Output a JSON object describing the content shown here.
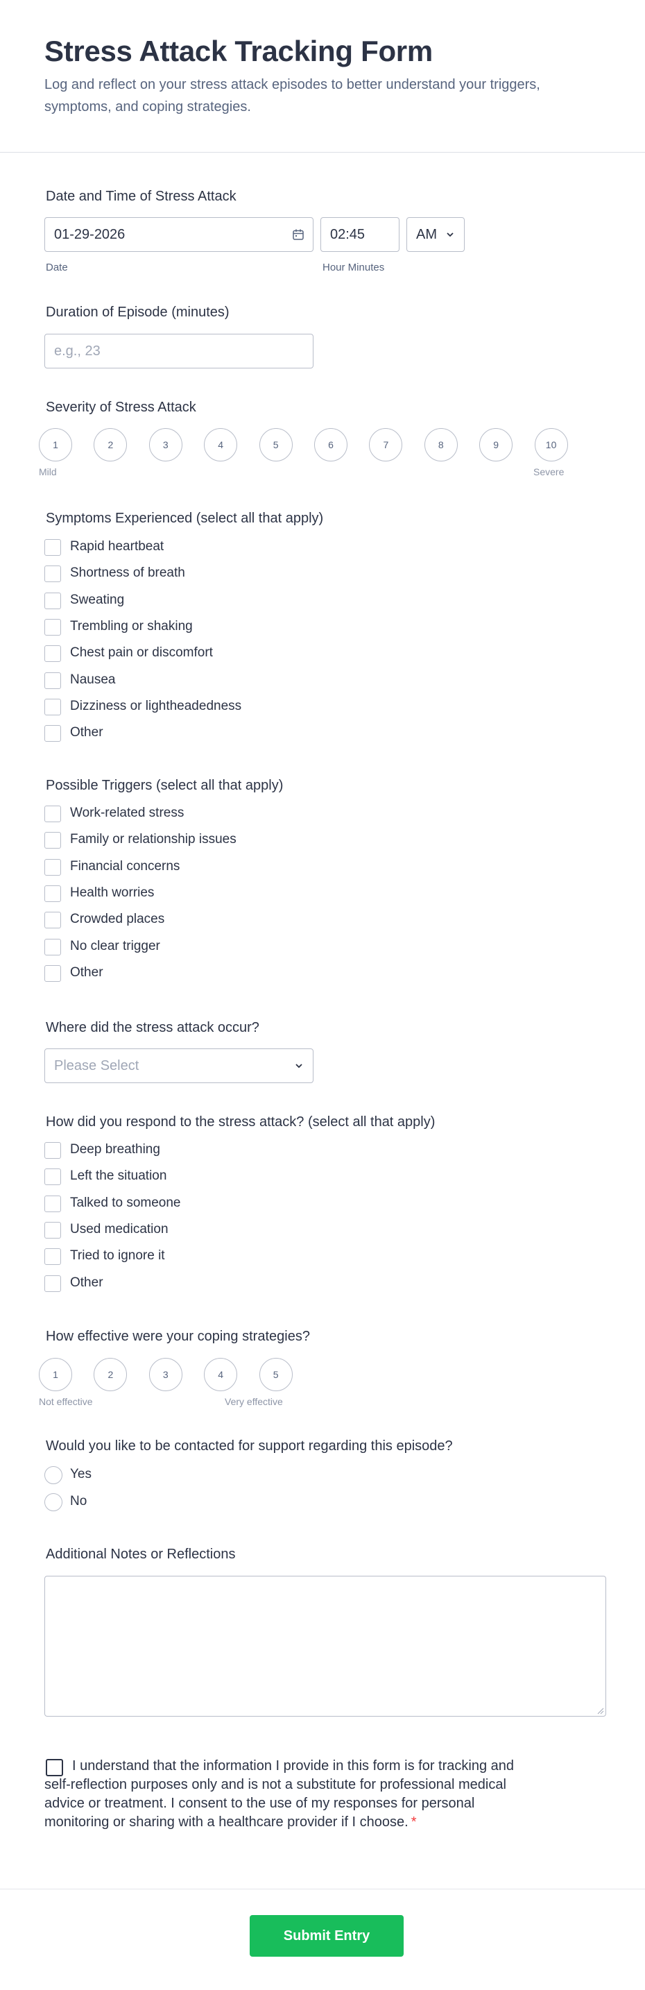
{
  "form": {
    "title": "Stress Attack Tracking Form",
    "subtitle": "Log and reflect on your stress attack episodes to better understand your triggers, symptoms, and coping strategies."
  },
  "datetime": {
    "label": "Date and Time of Stress Attack",
    "date_value": "01-29-2026",
    "date_sublabel": "Date",
    "time_value": "02:45",
    "time_sublabel": "Hour Minutes",
    "ampm_value": "AM"
  },
  "duration": {
    "label": "Duration of Episode (minutes)",
    "placeholder": "e.g., 23"
  },
  "severity": {
    "label": "Severity of Stress Attack",
    "options": [
      "1",
      "2",
      "3",
      "4",
      "5",
      "6",
      "7",
      "8",
      "9",
      "10"
    ],
    "min_label": "Mild",
    "max_label": "Severe"
  },
  "symptoms": {
    "label": "Symptoms Experienced (select all that apply)",
    "options": [
      "Rapid heartbeat",
      "Shortness of breath",
      "Sweating",
      "Trembling or shaking",
      "Chest pain or discomfort",
      "Nausea",
      "Dizziness or lightheadedness",
      "Other"
    ]
  },
  "triggers": {
    "label": "Possible Triggers (select all that apply)",
    "options": [
      "Work-related stress",
      "Family or relationship issues",
      "Financial concerns",
      "Health worries",
      "Crowded places",
      "No clear trigger",
      "Other"
    ]
  },
  "location": {
    "label": "Where did the stress attack occur?",
    "placeholder": "Please Select"
  },
  "response": {
    "label": "How did you respond to the stress attack? (select all that apply)",
    "options": [
      "Deep breathing",
      "Left the situation",
      "Talked to someone",
      "Used medication",
      "Tried to ignore it",
      "Other"
    ]
  },
  "effectiveness": {
    "label": "How effective were your coping strategies?",
    "options": [
      "1",
      "2",
      "3",
      "4",
      "5"
    ],
    "min_label": "Not effective",
    "max_label": "Very effective"
  },
  "contact": {
    "label": "Would you like to be contacted for support regarding this episode?",
    "options": [
      "Yes",
      "No"
    ]
  },
  "notes": {
    "label": "Additional Notes or Reflections"
  },
  "consent": {
    "text": "I understand that the information I provide in this form is for tracking and self-reflection purposes only and is not a substitute for professional medical advice or treatment. I consent to the use of my responses for personal monitoring or sharing with a healthcare provider if I choose.",
    "required_mark": "*"
  },
  "submit": {
    "label": "Submit Entry"
  },
  "colors": {
    "accent": "#18bd5b",
    "text": "#2c3345",
    "required": "#f23a3c"
  }
}
